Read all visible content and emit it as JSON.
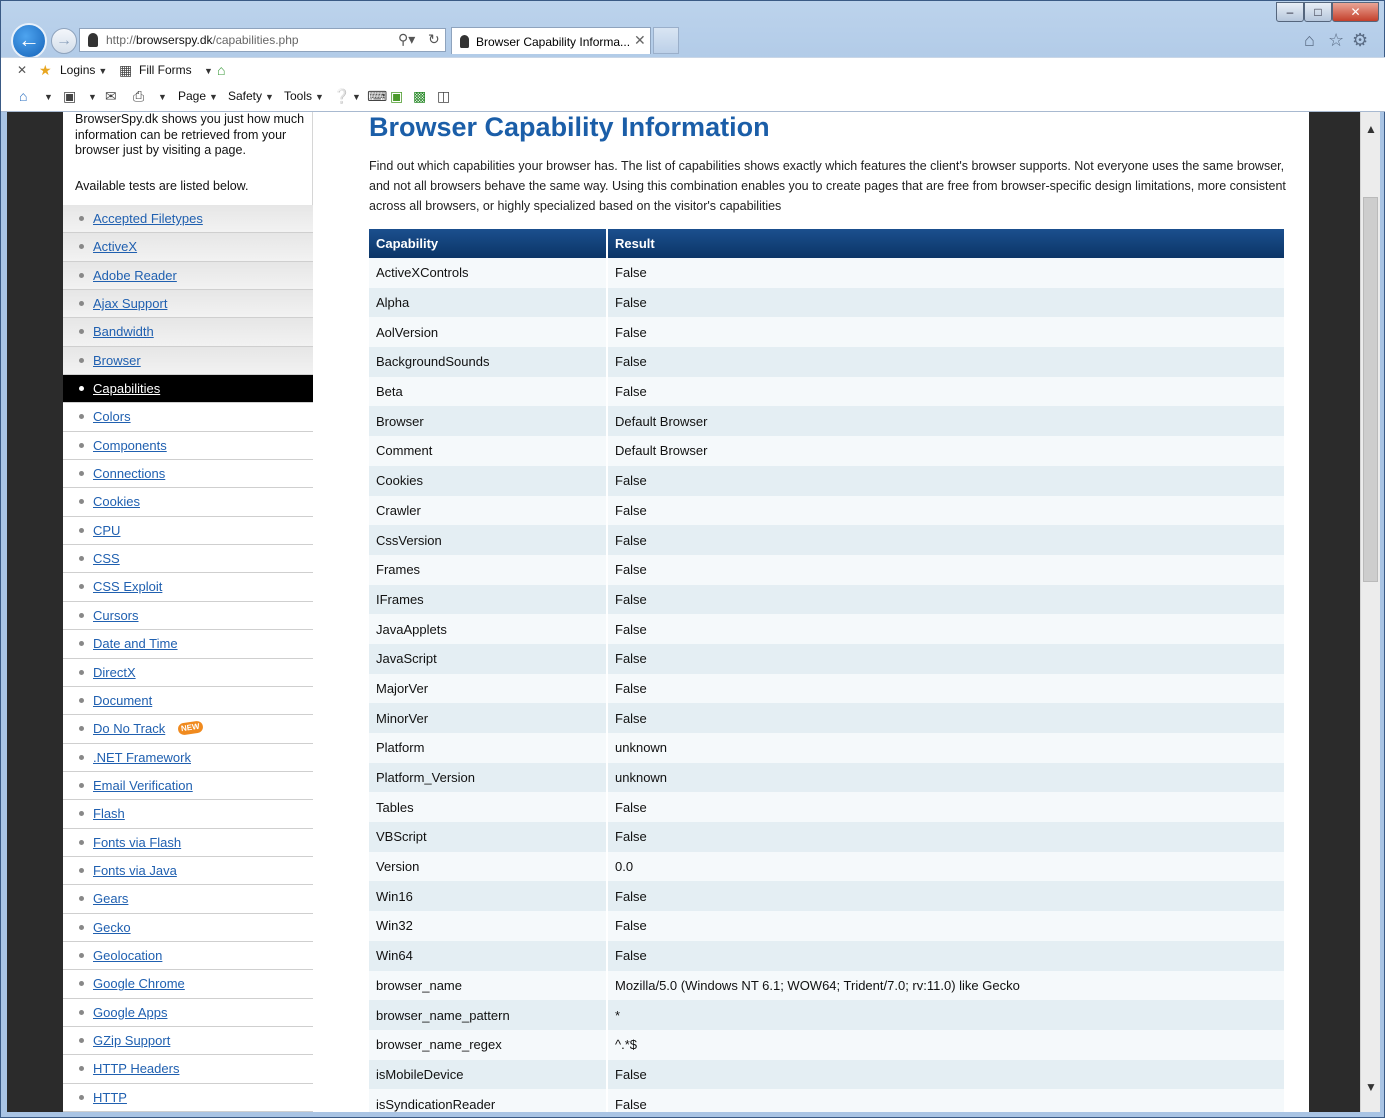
{
  "window": {
    "min_label": "–",
    "max_label": "□",
    "close_label": "✕"
  },
  "address_bar": {
    "url_prefix": "http://",
    "url_host": "browserspy.dk",
    "url_path": "/capabilities.php"
  },
  "tab": {
    "title": "Browser Capability Informa...",
    "close": "✕"
  },
  "commandbar": {
    "close": "✕",
    "logins": "Logins",
    "fill_forms": "Fill Forms",
    "page": "Page",
    "safety": "Safety",
    "tools": "Tools"
  },
  "sidebar": {
    "intro": "BrowserSpy.dk shows you just how much information can be retrieved from your browser just by visiting a page.",
    "intro2": "Available tests are listed below.",
    "items": [
      {
        "label": "Accepted Filetypes"
      },
      {
        "label": "ActiveX"
      },
      {
        "label": "Adobe Reader"
      },
      {
        "label": "Ajax Support"
      },
      {
        "label": "Bandwidth"
      },
      {
        "label": "Browser"
      },
      {
        "label": "Capabilities"
      },
      {
        "label": "Colors"
      },
      {
        "label": "Components"
      },
      {
        "label": "Connections"
      },
      {
        "label": "Cookies"
      },
      {
        "label": "CPU"
      },
      {
        "label": "CSS"
      },
      {
        "label": "CSS Exploit"
      },
      {
        "label": "Cursors"
      },
      {
        "label": "Date and Time"
      },
      {
        "label": "DirectX"
      },
      {
        "label": "Document"
      },
      {
        "label": "Do No Track",
        "badge": "NEW"
      },
      {
        "label": ".NET Framework"
      },
      {
        "label": "Email Verification"
      },
      {
        "label": "Flash"
      },
      {
        "label": "Fonts via Flash"
      },
      {
        "label": "Fonts via Java"
      },
      {
        "label": "Gears"
      },
      {
        "label": "Gecko"
      },
      {
        "label": "Geolocation"
      },
      {
        "label": "Google Chrome"
      },
      {
        "label": "Google Apps"
      },
      {
        "label": "GZip Support"
      },
      {
        "label": "HTTP Headers"
      },
      {
        "label": "HTTP"
      }
    ],
    "active_index": 6
  },
  "main": {
    "heading": "Browser Capability Information",
    "description": "Find out which capabilities your browser has. The list of capabilities shows exactly which features the client's browser supports. Not everyone uses the same browser, and not all browsers behave the same way. Using this combination enables you to create pages that are free from browser-specific design limitations, more consistent across all browsers, or highly specialized based on the visitor's capabilities",
    "table": {
      "headers": [
        "Capability",
        "Result"
      ],
      "rows": [
        [
          "ActiveXControls",
          "False"
        ],
        [
          "Alpha",
          "False"
        ],
        [
          "AolVersion",
          "False"
        ],
        [
          "BackgroundSounds",
          "False"
        ],
        [
          "Beta",
          "False"
        ],
        [
          "Browser",
          "Default Browser"
        ],
        [
          "Comment",
          "Default Browser"
        ],
        [
          "Cookies",
          "False"
        ],
        [
          "Crawler",
          "False"
        ],
        [
          "CssVersion",
          "False"
        ],
        [
          "Frames",
          "False"
        ],
        [
          "IFrames",
          "False"
        ],
        [
          "JavaApplets",
          "False"
        ],
        [
          "JavaScript",
          "False"
        ],
        [
          "MajorVer",
          "False"
        ],
        [
          "MinorVer",
          "False"
        ],
        [
          "Platform",
          "unknown"
        ],
        [
          "Platform_Version",
          "unknown"
        ],
        [
          "Tables",
          "False"
        ],
        [
          "VBScript",
          "False"
        ],
        [
          "Version",
          "0.0"
        ],
        [
          "Win16",
          "False"
        ],
        [
          "Win32",
          "False"
        ],
        [
          "Win64",
          "False"
        ],
        [
          "browser_name",
          "Mozilla/5.0 (Windows NT 6.1; WOW64; Trident/7.0; rv:11.0) like Gecko"
        ],
        [
          "browser_name_pattern",
          "*"
        ],
        [
          "browser_name_regex",
          "^.*$"
        ],
        [
          "isMobileDevice",
          "False"
        ],
        [
          "isSyndicationReader",
          "False"
        ]
      ]
    }
  }
}
